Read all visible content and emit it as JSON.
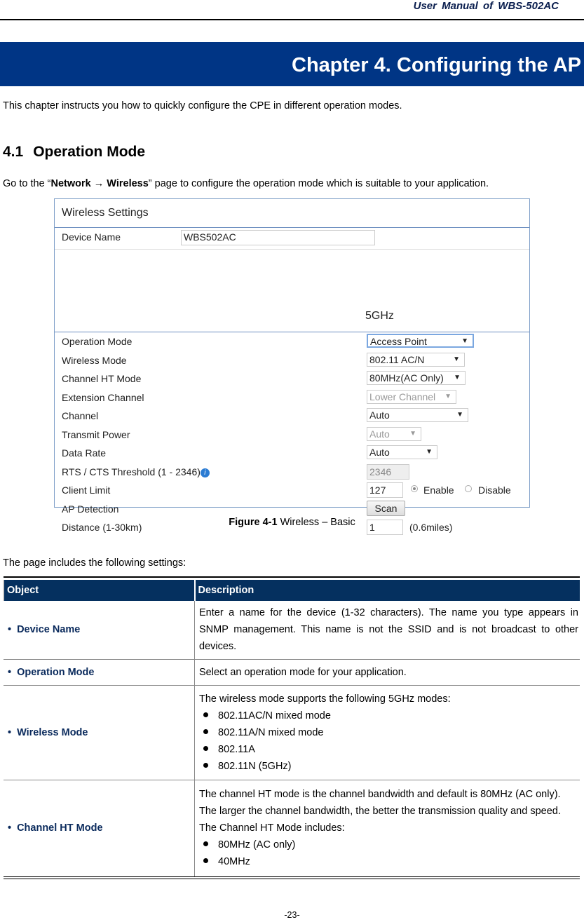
{
  "header": {
    "title": "User  Manual  of  WBS-502AC"
  },
  "chapter": {
    "title": "Chapter 4.    Configuring the AP"
  },
  "intro": "This chapter instructs you how to quickly configure the CPE in different operation modes.",
  "section": {
    "number": "4.1",
    "title": "Operation Mode"
  },
  "goto": {
    "pre": "Go to the “",
    "bold": "Network → Wireless",
    "post": "” page to configure the operation mode which is suitable to your application."
  },
  "figure": {
    "title": "Wireless Settings",
    "device_name_label": "Device Name",
    "device_name_value": "WBS502AC",
    "band": "5GHz",
    "rows": [
      {
        "label": "Operation Mode",
        "value": "Access Point"
      },
      {
        "label": "Wireless Mode",
        "value": "802.11 AC/N"
      },
      {
        "label": "Channel HT Mode",
        "value": "80MHz(AC Only)"
      },
      {
        "label": "Extension Channel",
        "value": "Lower Channel"
      },
      {
        "label": "Channel",
        "value": "Auto"
      },
      {
        "label": "Transmit Power",
        "value": "Auto"
      },
      {
        "label": "Data Rate",
        "value": "Auto"
      },
      {
        "label": "RTS / CTS Threshold (1 - 2346)",
        "value": "2346"
      },
      {
        "label": "Client Limit",
        "value": "127",
        "radio_enable": "Enable",
        "radio_disable": "Disable"
      },
      {
        "label": "AP Detection",
        "value": "Scan"
      },
      {
        "label": "Distance (1-30km)",
        "value": "1",
        "unit": "(0.6miles)"
      }
    ],
    "arrow": "▼",
    "info_glyph": "i"
  },
  "caption": {
    "bold": "Figure 4-1",
    "text": " Wireless – Basic"
  },
  "settings_intro": "The page includes the following settings:",
  "table": {
    "headers": [
      "Object",
      "Description"
    ],
    "bullet": "•",
    "rows": [
      {
        "object": "Device Name",
        "desc": "Enter a name for the device (1-32 characters). The name you type appears in SNMP management. This name is not the SSID and is not broadcast to other devices."
      },
      {
        "object": "Operation Mode",
        "desc": "Select an operation mode for your application."
      },
      {
        "object": "Wireless Mode",
        "desc": "The wireless mode supports the following 5GHz modes:",
        "items": [
          "802.11AC/N mixed mode",
          "802.11A/N mixed mode",
          "802.11A",
          "802.11N (5GHz)"
        ]
      },
      {
        "object": "Channel HT Mode",
        "desc": "The channel HT mode is the channel bandwidth and default is 80MHz (AC only). The larger the channel bandwidth, the better the transmission quality and speed. The Channel HT Mode includes:",
        "items": [
          "80MHz (AC only)",
          "40MHz"
        ]
      }
    ]
  },
  "page_number": "-23-"
}
